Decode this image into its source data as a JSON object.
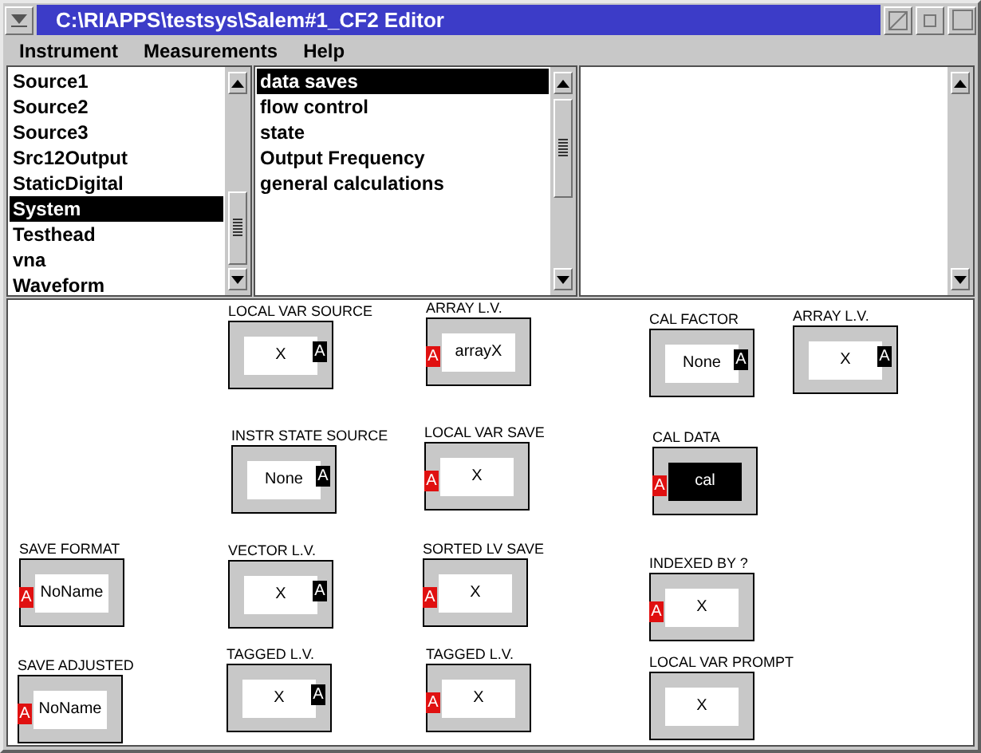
{
  "window": {
    "title": "C:\\RIAPPS\\testsys\\Salem#1_CF2 Editor"
  },
  "menu": [
    {
      "label": "Instrument"
    },
    {
      "label": "Measurements"
    },
    {
      "label": "Help"
    }
  ],
  "instruments": [
    {
      "label": "Source1",
      "selected": false
    },
    {
      "label": "Source2",
      "selected": false
    },
    {
      "label": "Source3",
      "selected": false
    },
    {
      "label": "Src12Output",
      "selected": false
    },
    {
      "label": "StaticDigital",
      "selected": false
    },
    {
      "label": "System",
      "selected": true
    },
    {
      "label": "Testhead",
      "selected": false
    },
    {
      "label": "vna",
      "selected": false
    },
    {
      "label": "Waveform",
      "selected": false
    }
  ],
  "measurements": [
    {
      "label": "data saves",
      "selected": true
    },
    {
      "label": "flow control",
      "selected": false
    },
    {
      "label": "state",
      "selected": false
    },
    {
      "label": "Output Frequency",
      "selected": false
    },
    {
      "label": "general calculations",
      "selected": false
    }
  ],
  "blocks": [
    {
      "label": "LOCAL VAR SOURCE",
      "value": "X",
      "kind": "right_port",
      "port_label": "A",
      "selected": false
    },
    {
      "label": "ARRAY L.V.",
      "value": "arrayX",
      "kind": "left_port",
      "port_label": "A",
      "selected": false
    },
    {
      "label": "CAL FACTOR",
      "value": "None",
      "kind": "right_port",
      "port_label": "A",
      "selected": false
    },
    {
      "label": "ARRAY L.V.",
      "value": "X",
      "kind": "right_port",
      "port_label": "A",
      "selected": false
    },
    {
      "label": "INSTR STATE SOURCE",
      "value": "None",
      "kind": "right_port",
      "port_label": "A",
      "selected": false
    },
    {
      "label": "LOCAL VAR SAVE",
      "value": "X",
      "kind": "left_port",
      "port_label": "A",
      "selected": false
    },
    {
      "label": "CAL DATA",
      "value": "cal",
      "kind": "left_port",
      "port_label": "A",
      "selected": true
    },
    {
      "label": "SAVE FORMAT",
      "value": "NoName",
      "kind": "left_port",
      "port_label": "A",
      "selected": false
    },
    {
      "label": "VECTOR L.V.",
      "value": "X",
      "kind": "right_port",
      "port_label": "A",
      "selected": false
    },
    {
      "label": "SORTED LV SAVE",
      "value": "X",
      "kind": "left_port",
      "port_label": "A",
      "selected": false
    },
    {
      "label": "INDEXED BY ?",
      "value": "X",
      "kind": "left_port",
      "port_label": "A",
      "selected": false
    },
    {
      "label": "SAVE ADJUSTED",
      "value": "NoName",
      "kind": "left_port",
      "port_label": "A",
      "selected": false
    },
    {
      "label": "TAGGED L.V.",
      "value": "X",
      "kind": "right_port",
      "port_label": "A",
      "selected": false
    },
    {
      "label": "TAGGED L.V.",
      "value": "X",
      "kind": "left_port",
      "port_label": "A",
      "selected": false
    },
    {
      "label": "LOCAL VAR PROMPT",
      "value": "X",
      "kind": "no_port",
      "selected": false
    }
  ]
}
